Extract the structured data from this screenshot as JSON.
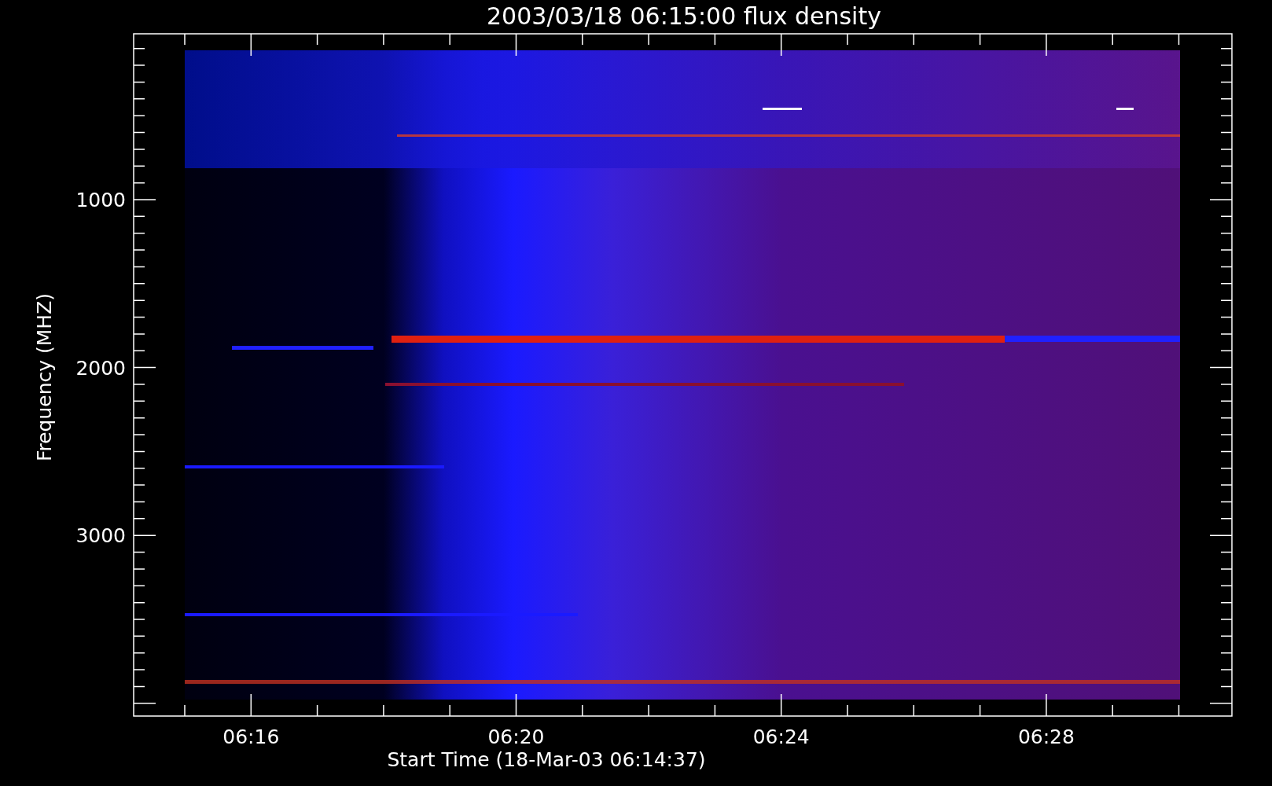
{
  "plot": {
    "title": "2003/03/18 06:15:00 flux density",
    "ylabel": "Frequency (MHZ)",
    "xlabel": "Start Time (18-Mar-03 06:14:37)",
    "y_tick_labels": [
      "1000",
      "2000",
      "3000"
    ],
    "x_tick_labels": [
      "06:16",
      "06:20",
      "06:24",
      "06:28"
    ]
  }
}
